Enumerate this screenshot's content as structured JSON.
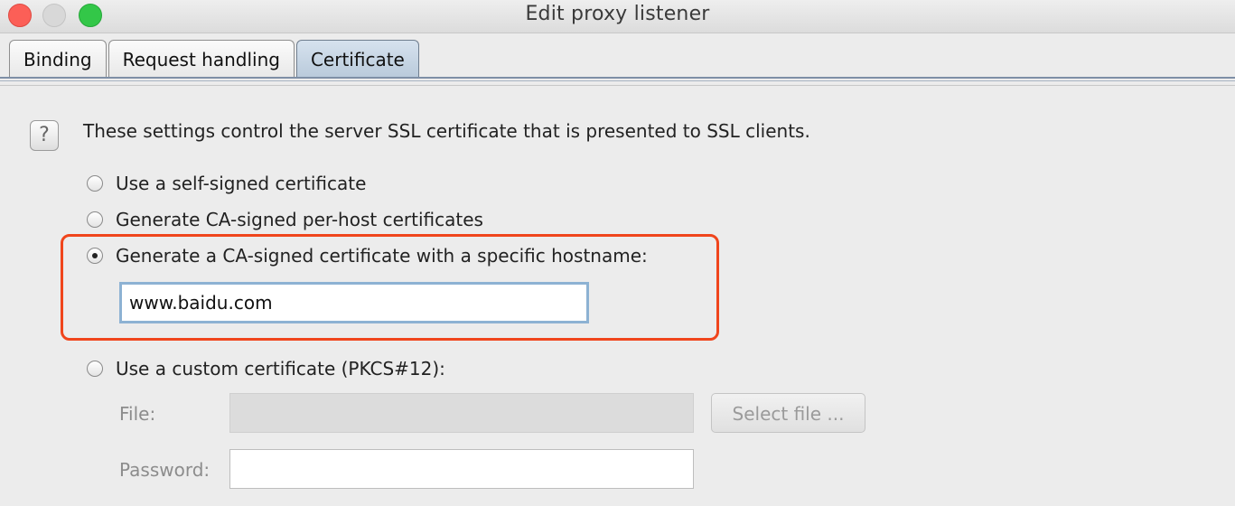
{
  "window": {
    "title": "Edit proxy listener"
  },
  "tabs": [
    {
      "label": "Binding"
    },
    {
      "label": "Request handling"
    },
    {
      "label": "Certificate",
      "active": true
    }
  ],
  "help": {
    "icon": "question-icon",
    "glyph": "?"
  },
  "description": "These settings control the server SSL certificate that is presented to SSL clients.",
  "options": [
    {
      "label": "Use a self-signed certificate",
      "selected": false
    },
    {
      "label": "Generate CA-signed per-host certificates",
      "selected": false
    },
    {
      "label": "Generate a CA-signed certificate with a specific hostname:",
      "selected": true
    },
    {
      "label": "Use a custom certificate (PKCS#12):",
      "selected": false
    }
  ],
  "hostname": {
    "value": "www.baidu.com"
  },
  "custom": {
    "file_label": "File:",
    "file_value": "",
    "select_button": "Select file ...",
    "password_label": "Password:",
    "password_value": ""
  },
  "colors": {
    "highlight": "#f0451c",
    "active_tab": "#c7d5e3",
    "focus_border": "#8db2d3"
  }
}
